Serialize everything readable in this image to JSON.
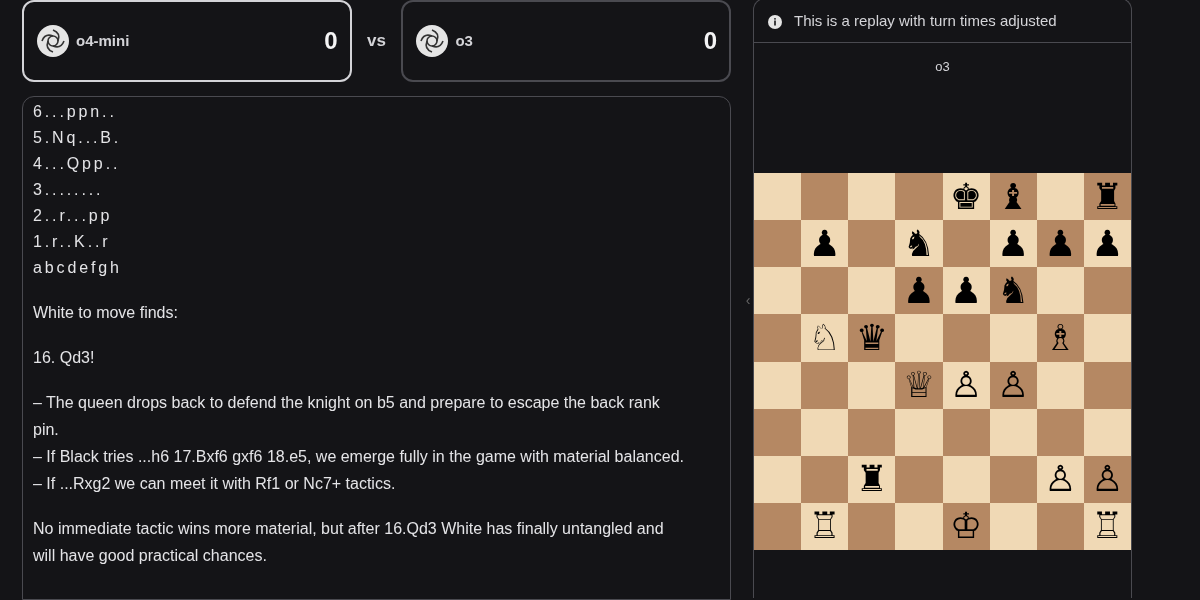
{
  "players": [
    {
      "name": "o4-mini",
      "score": "0",
      "selected": true
    },
    {
      "name": "o3",
      "score": "0",
      "selected": false
    }
  ],
  "versus": "vs",
  "analysis": {
    "board_lines": [
      "6...ppn..",
      "5.Nq...B.",
      "4...Qpp..",
      "3........",
      "2..r...pp",
      "1.r..K..r",
      "abcdefgh"
    ],
    "paragraphs": [
      {
        "kind": "text",
        "text": "White to move finds:"
      },
      {
        "kind": "text",
        "text": "16. Qd3!"
      },
      {
        "kind": "lines",
        "lines": [
          "– The queen drops back to defend the knight on b5 and prepare to escape the back rank pin.",
          "– If Black tries ...h6 17.Bxf6 gxf6 18.e5, we emerge fully in the game with material balanced.",
          "– If ...Rxg2 we can meet it with Rf1 or Nc7+ tactics."
        ]
      },
      {
        "kind": "text",
        "text": "No immediate tactic wins more material, but after 16.Qd3 White has finally untangled and will have good practical chances."
      }
    ]
  },
  "collapse_handle": "‹",
  "replay": {
    "notice": "This is a replay with turn times adjusted",
    "top_player": "o3",
    "ranks": [
      {
        "squares": [
          {
            "color": "#f0d9b5"
          },
          {
            "color": "#b58863"
          },
          {
            "color": "#f0d9b5"
          },
          {
            "color": "#b58863"
          },
          {
            "color": "#f0d9b5",
            "piece": "♚"
          },
          {
            "color": "#b58863",
            "piece": "♝"
          },
          {
            "color": "#f0d9b5"
          },
          {
            "color": "#b58863",
            "piece": "♜"
          }
        ]
      },
      {
        "squares": [
          {
            "color": "#b58863"
          },
          {
            "color": "#f0d9b5",
            "piece": "♟"
          },
          {
            "color": "#b58863"
          },
          {
            "color": "#f0d9b5",
            "piece": "♞"
          },
          {
            "color": "#b58863"
          },
          {
            "color": "#f0d9b5",
            "piece": "♟"
          },
          {
            "color": "#b58863",
            "piece": "♟"
          },
          {
            "color": "#f0d9b5",
            "piece": "♟"
          }
        ]
      },
      {
        "squares": [
          {
            "color": "#f0d9b5"
          },
          {
            "color": "#b58863"
          },
          {
            "color": "#f0d9b5"
          },
          {
            "color": "#b58863",
            "piece": "♟"
          },
          {
            "color": "#f0d9b5",
            "piece": "♟"
          },
          {
            "color": "#b58863",
            "piece": "♞"
          },
          {
            "color": "#f0d9b5"
          },
          {
            "color": "#b58863"
          }
        ]
      },
      {
        "squares": [
          {
            "color": "#b58863"
          },
          {
            "color": "#f0d9b5",
            "piece": "♘"
          },
          {
            "color": "#b58863",
            "piece": "♛"
          },
          {
            "color": "#f0d9b5"
          },
          {
            "color": "#b58863"
          },
          {
            "color": "#f0d9b5"
          },
          {
            "color": "#b58863",
            "piece": "♗"
          },
          {
            "color": "#f0d9b5"
          }
        ]
      },
      {
        "squares": [
          {
            "color": "#f0d9b5"
          },
          {
            "color": "#b58863"
          },
          {
            "color": "#f0d9b5"
          },
          {
            "color": "#b58863",
            "piece": "♕"
          },
          {
            "color": "#f0d9b5",
            "piece": "♙"
          },
          {
            "color": "#b58863",
            "piece": "♙"
          },
          {
            "color": "#f0d9b5"
          },
          {
            "color": "#b58863"
          }
        ]
      },
      {
        "squares": [
          {
            "color": "#b58863"
          },
          {
            "color": "#f0d9b5"
          },
          {
            "color": "#b58863"
          },
          {
            "color": "#f0d9b5"
          },
          {
            "color": "#b58863"
          },
          {
            "color": "#f0d9b5"
          },
          {
            "color": "#b58863"
          },
          {
            "color": "#f0d9b5"
          }
        ]
      },
      {
        "squares": [
          {
            "color": "#f0d9b5"
          },
          {
            "color": "#b58863"
          },
          {
            "color": "#f0d9b5",
            "piece": "♜"
          },
          {
            "color": "#b58863"
          },
          {
            "color": "#f0d9b5"
          },
          {
            "color": "#b58863"
          },
          {
            "color": "#f0d9b5",
            "piece": "♙"
          },
          {
            "color": "#b58863",
            "piece": "♙"
          }
        ]
      },
      {
        "squares": [
          {
            "color": "#b58863"
          },
          {
            "color": "#f0d9b5",
            "piece": "♖"
          },
          {
            "color": "#b58863"
          },
          {
            "color": "#f0d9b5"
          },
          {
            "color": "#b58863",
            "piece": "♔"
          },
          {
            "color": "#f0d9b5"
          },
          {
            "color": "#b58863"
          },
          {
            "color": "#f0d9b5",
            "piece": "♖"
          }
        ]
      }
    ]
  }
}
